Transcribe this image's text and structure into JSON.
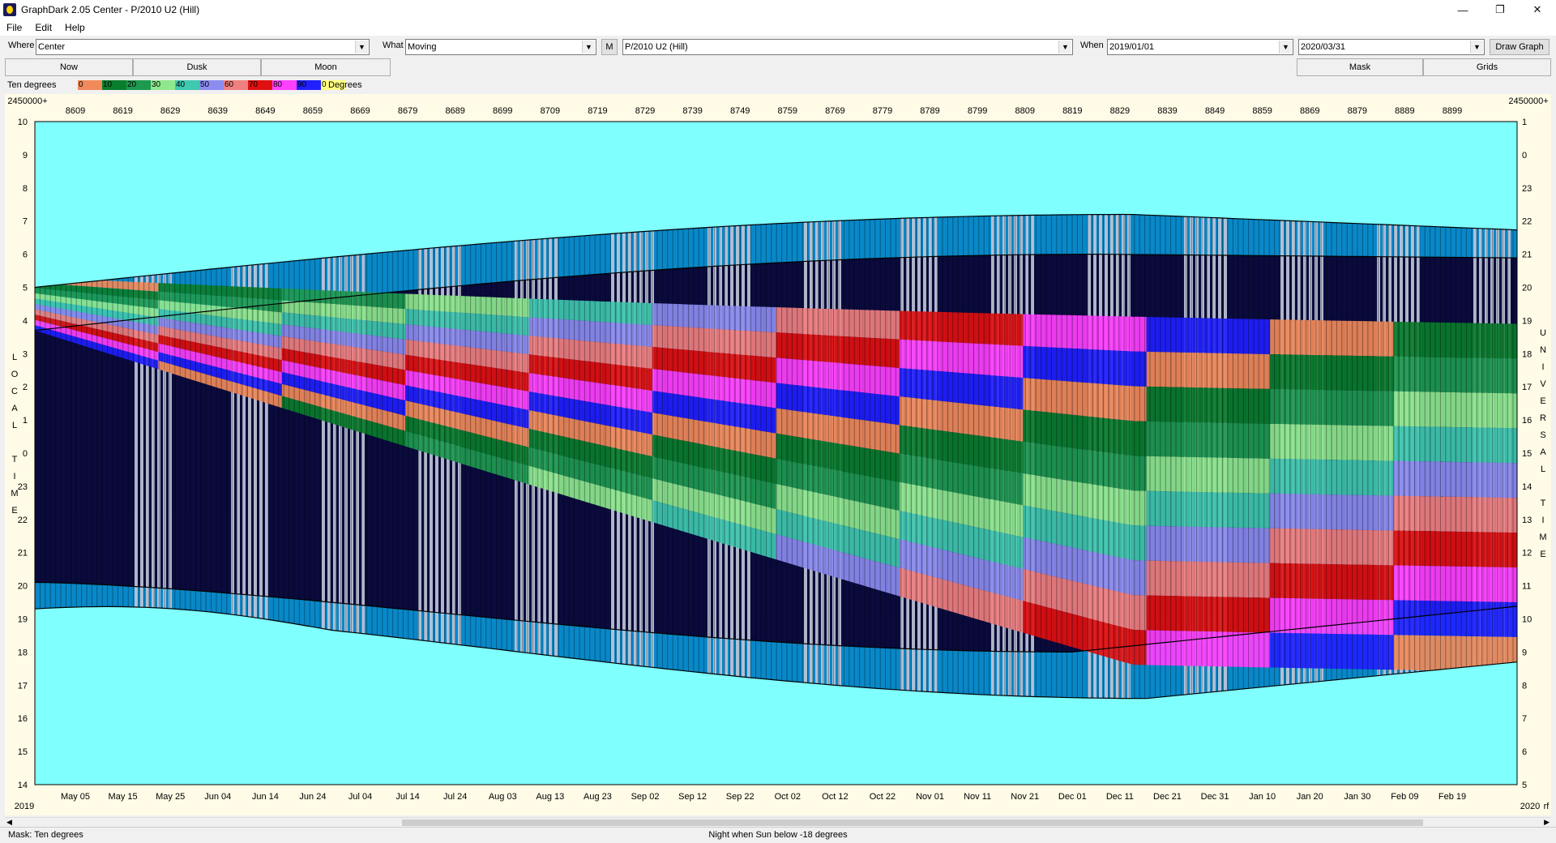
{
  "window": {
    "title": "GraphDark 2.05  Center  -  P/2010 U2 (Hill)",
    "min_glyph": "—",
    "max_glyph": "❐",
    "close_glyph": "✕",
    "icon": "moon-app-icon"
  },
  "menu": [
    "File",
    "Edit",
    "Help"
  ],
  "toolbar": {
    "where_label": "Where",
    "where_value": "Center",
    "what_label": "What",
    "what_value": "Moving",
    "m_button": "M",
    "object_value": "P/2010 U2 (Hill)",
    "when_label": "When",
    "start_date": "2019/01/01",
    "end_date": "2020/03/31",
    "draw_button": "Draw Graph"
  },
  "row2": {
    "now": "Now",
    "dusk": "Dusk",
    "moon": "Moon",
    "mask": "Mask",
    "grids": "Grids"
  },
  "legend": {
    "title": "Ten degrees",
    "units": "Degrees",
    "swatches": [
      {
        "label": "0",
        "color": "#f08a5a"
      },
      {
        "label": "10",
        "color": "#0a7d2c"
      },
      {
        "label": "20",
        "color": "#1e9a50"
      },
      {
        "label": "30",
        "color": "#8ee88e"
      },
      {
        "label": "40",
        "color": "#40c8b0"
      },
      {
        "label": "50",
        "color": "#8c8cf0"
      },
      {
        "label": "60",
        "color": "#f08080"
      },
      {
        "label": "70",
        "color": "#e01010"
      },
      {
        "label": "80",
        "color": "#ff40ff"
      },
      {
        "label": "90",
        "color": "#2020ff"
      },
      {
        "label": "0",
        "color": "#ffff80"
      }
    ]
  },
  "chart_data": {
    "type": "heatmap",
    "jd_prefix_left": "2450000+",
    "jd_prefix_right": "2450000+",
    "jd_ticks": [
      "8609",
      "8619",
      "8629",
      "8639",
      "8649",
      "8659",
      "8669",
      "8679",
      "8689",
      "8699",
      "8709",
      "8719",
      "8729",
      "8739",
      "8749",
      "8759",
      "8769",
      "8779",
      "8789",
      "8799",
      "8809",
      "8819",
      "8829",
      "8839",
      "8849",
      "8859",
      "8869",
      "8879",
      "8889",
      "8899"
    ],
    "date_ticks": [
      "May 05",
      "May 15",
      "May 25",
      "Jun 04",
      "Jun 14",
      "Jun 24",
      "Jul 04",
      "Jul 14",
      "Jul 24",
      "Aug 03",
      "Aug 13",
      "Aug 23",
      "Sep 02",
      "Sep 12",
      "Sep 22",
      "Oct 02",
      "Oct 12",
      "Oct 22",
      "Nov 01",
      "Nov 11",
      "Nov 21",
      "Dec 01",
      "Dec 11",
      "Dec 21",
      "Dec 31",
      "Jan 10",
      "Jan 20",
      "Jan 30",
      "Feb 09",
      "Feb 19"
    ],
    "year_left": "2019",
    "year_right": "2020",
    "corner_right": "rf",
    "y_left_label": "LOCAL TIME",
    "y_right_label": "UNIVERSAL TIME",
    "y_left_ticks": [
      "10",
      "9",
      "8",
      "7",
      "6",
      "5",
      "4",
      "3",
      "2",
      "1",
      "0",
      "23",
      "22",
      "21",
      "20",
      "19",
      "18",
      "17",
      "16",
      "15",
      "14"
    ],
    "y_right_ticks": [
      "1",
      "0",
      "23",
      "22",
      "21",
      "20",
      "19",
      "18",
      "17",
      "16",
      "15",
      "14",
      "13",
      "12",
      "11",
      "10",
      "9",
      "8",
      "7",
      "6",
      "5"
    ],
    "colors": {
      "day": "#80ffff",
      "night": "#0a0a3c",
      "moon": "#c0c8d8",
      "twilight": "#0888c8"
    }
  },
  "status": {
    "mask": "Mask:  Ten degrees",
    "night": "Night when Sun below -18 degrees"
  }
}
